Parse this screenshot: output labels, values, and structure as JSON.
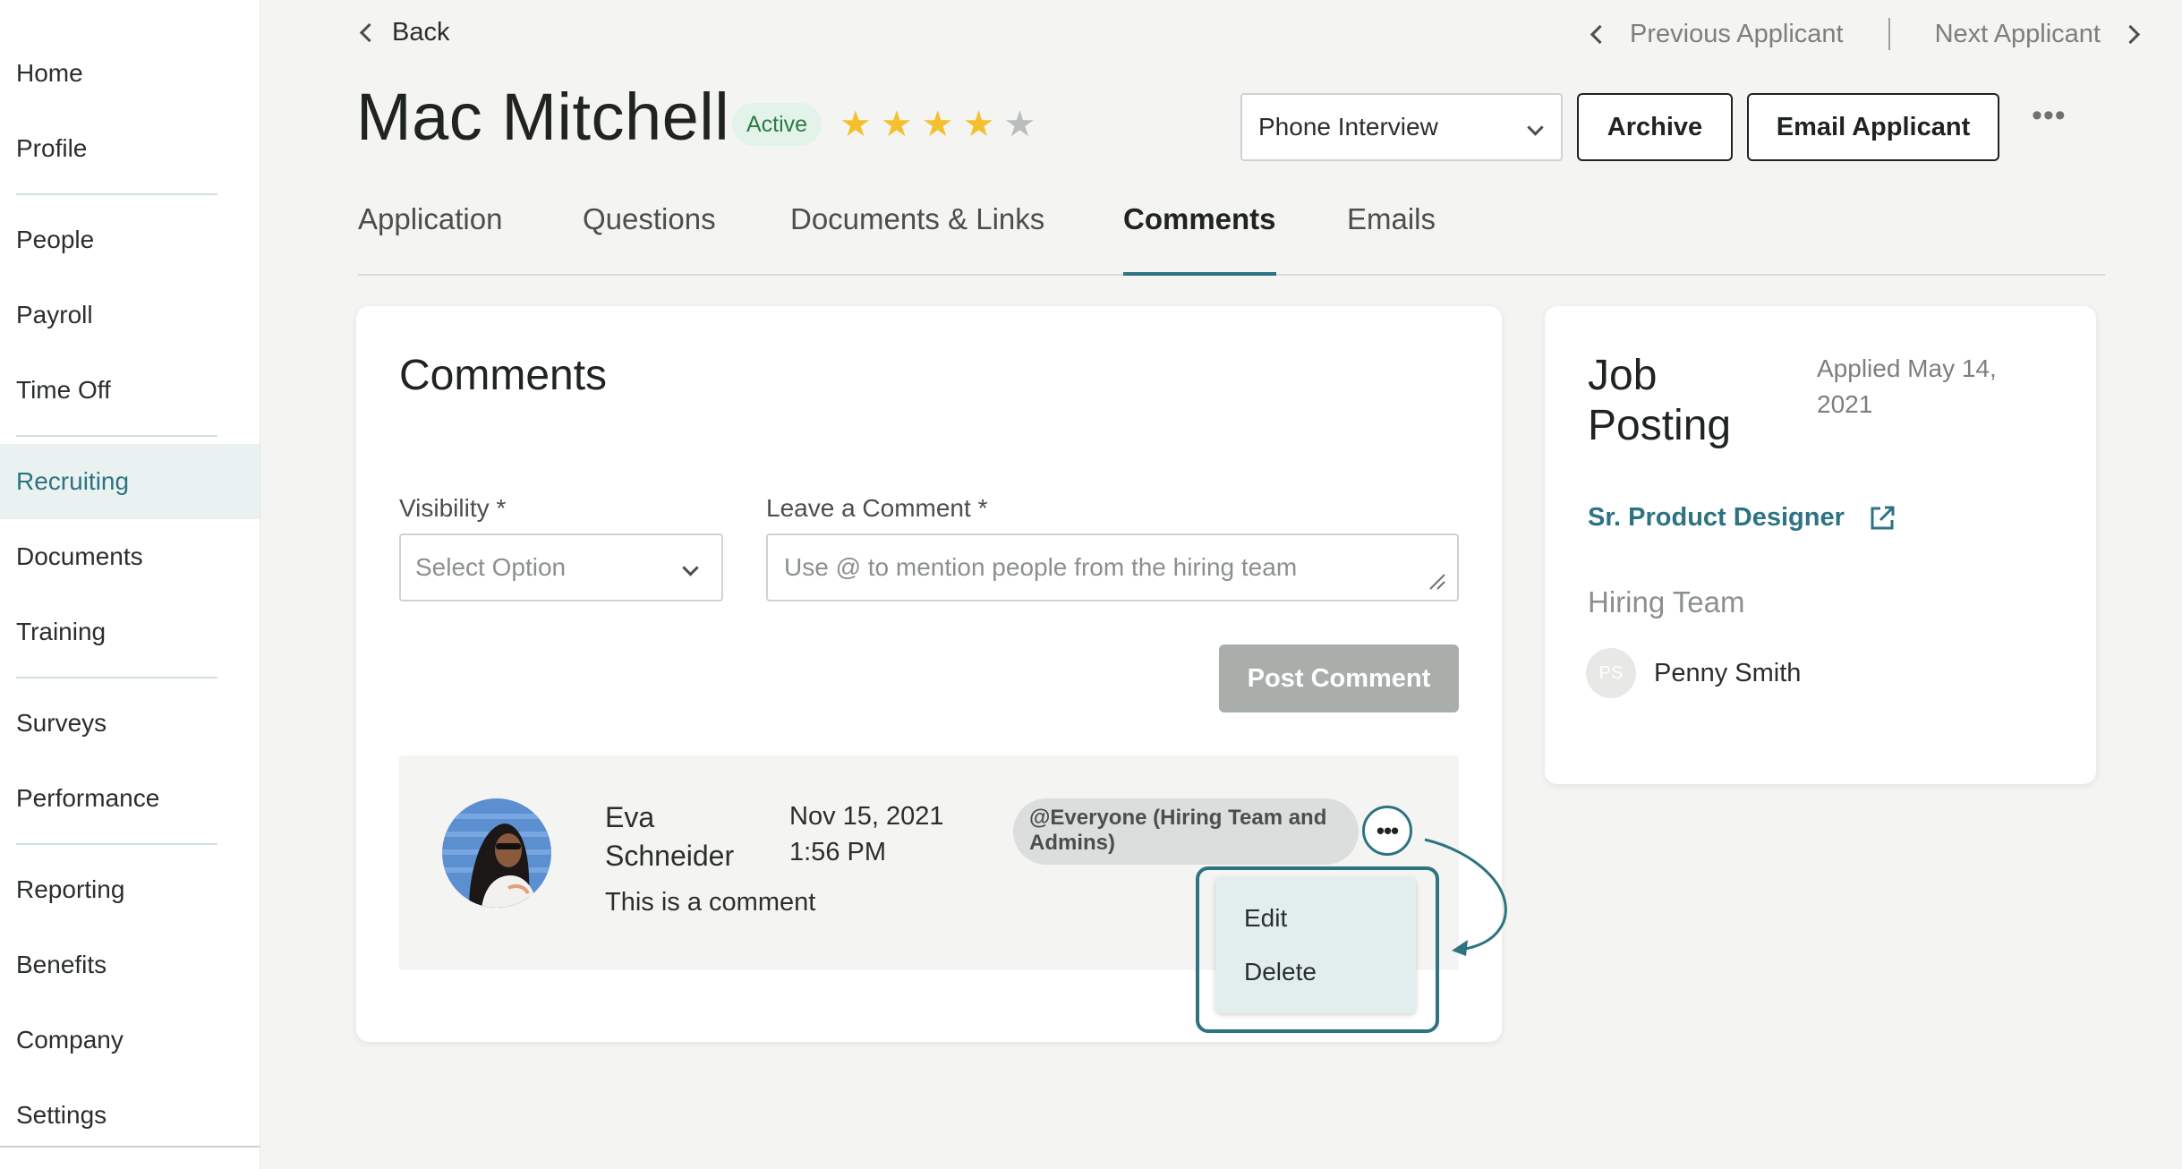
{
  "sidebar": {
    "items": [
      {
        "label": "Home",
        "active": false
      },
      {
        "label": "Profile",
        "active": false
      },
      {
        "label": "People",
        "active": false
      },
      {
        "label": "Payroll",
        "active": false
      },
      {
        "label": "Time Off",
        "active": false
      },
      {
        "label": "Recruiting",
        "active": true
      },
      {
        "label": "Documents",
        "active": false
      },
      {
        "label": "Training",
        "active": false
      },
      {
        "label": "Surveys",
        "active": false
      },
      {
        "label": "Performance",
        "active": false
      },
      {
        "label": "Reporting",
        "active": false
      },
      {
        "label": "Benefits",
        "active": false
      },
      {
        "label": "Company",
        "active": false
      },
      {
        "label": "Settings",
        "active": false
      }
    ]
  },
  "header": {
    "back_label": "Back",
    "previous_label": "Previous Applicant",
    "next_label": "Next Applicant",
    "applicant_name": "Mac Mitchell",
    "status": "Active",
    "rating": 4,
    "rating_max": 5,
    "stage_value": "Phone Interview",
    "archive_label": "Archive",
    "email_label": "Email Applicant",
    "more_label": "•••"
  },
  "tabs": [
    {
      "label": "Application",
      "active": false
    },
    {
      "label": "Questions",
      "active": false
    },
    {
      "label": "Documents & Links",
      "active": false
    },
    {
      "label": "Comments",
      "active": true
    },
    {
      "label": "Emails",
      "active": false
    }
  ],
  "comments": {
    "title": "Comments",
    "visibility_label": "Visibility *",
    "visibility_placeholder": "Select Option",
    "comment_label": "Leave a Comment *",
    "comment_placeholder": "Use @ to mention people from the hiring team",
    "post_label": "Post Comment",
    "items": [
      {
        "author": "Eva Schneider",
        "date": "Nov 15, 2021",
        "time": "1:56 PM",
        "visibility": "@Everyone (Hiring Team and Admins)",
        "text": "This is a comment",
        "more_label": "•••"
      }
    ],
    "menu": {
      "edit_label": "Edit",
      "delete_label": "Delete"
    }
  },
  "job_posting": {
    "title": "Job Posting",
    "applied": "Applied May 14, 2021",
    "job_title": "Sr. Product Designer",
    "hiring_team_label": "Hiring Team",
    "members": [
      {
        "initials": "PS",
        "name": "Penny Smith"
      }
    ]
  },
  "colors": {
    "accent": "#2d7381",
    "star": "#f4c12e",
    "badge_bg": "#e4f3ea",
    "badge_text": "#2c7a45"
  }
}
